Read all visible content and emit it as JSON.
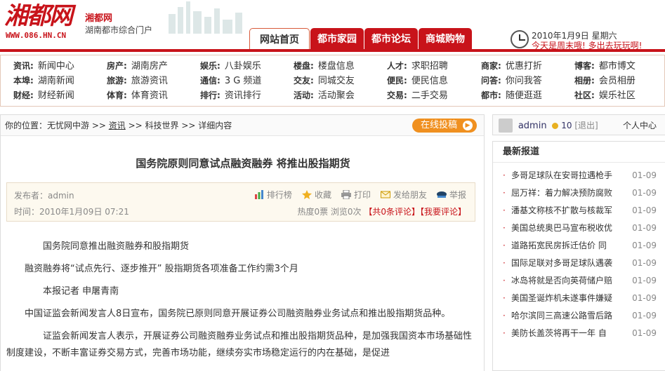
{
  "header": {
    "logo_text": "湘都网",
    "logo_url": "WWW.086.HN.CN",
    "site_name": "湘都网",
    "slogan": "湖南都市综合门户",
    "tabs": [
      "网站首页",
      "都市家园",
      "都市论坛",
      "商城购物"
    ],
    "date": "2010年1月9日 星期六",
    "tip": "今天是周末哦! 多出去玩玩啊!"
  },
  "catnav": [
    {
      "rows": [
        {
          "cat": "资讯:",
          "link": "新闻中心"
        },
        {
          "cat": "本埠:",
          "link": "湖南新闻"
        },
        {
          "cat": "财经:",
          "link": "财经新闻"
        }
      ]
    },
    {
      "rows": [
        {
          "cat": "房产:",
          "link": "湖南房产"
        },
        {
          "cat": "旅游:",
          "link": "旅游资讯"
        },
        {
          "cat": "体育:",
          "link": "体育资讯"
        }
      ]
    },
    {
      "rows": [
        {
          "cat": "娱乐:",
          "link": "八卦娱乐"
        },
        {
          "cat": "通信:",
          "link": "3 G 频道"
        },
        {
          "cat": "排行:",
          "link": "资讯排行"
        }
      ]
    },
    {
      "rows": [
        {
          "cat": "楼盘:",
          "link": "楼盘信息"
        },
        {
          "cat": "交友:",
          "link": "同城交友"
        },
        {
          "cat": "活动:",
          "link": "活动聚会"
        }
      ]
    },
    {
      "rows": [
        {
          "cat": "人才:",
          "link": "求职招聘"
        },
        {
          "cat": "便民:",
          "link": "便民信息"
        },
        {
          "cat": "交易:",
          "link": "二手交易"
        }
      ]
    },
    {
      "rows": [
        {
          "cat": "商家:",
          "link": "优惠打折"
        },
        {
          "cat": "问答:",
          "link": "你问我答"
        },
        {
          "cat": "都市:",
          "link": "随便逛逛"
        }
      ]
    },
    {
      "rows": [
        {
          "cat": "博客:",
          "link": "都市博文"
        },
        {
          "cat": "相册:",
          "link": "会员相册"
        },
        {
          "cat": "社区:",
          "link": "娱乐社区"
        }
      ]
    }
  ],
  "breadcrumb": {
    "prefix": "你的位置：无忧网中游 >>",
    "link": "资讯",
    "rest": ">> 科技世界 >> 详细内容"
  },
  "post_button": "在线投稿",
  "article": {
    "title": "国务院原则同意试点融资融券 将推出股指期货",
    "publisher": "发布者：admin",
    "time": "时间：2010年1月09日 07:21",
    "tools": [
      "排行榜",
      "收藏",
      "打印",
      "发给朋友",
      "举报"
    ],
    "stats_plain": "热度0票 浏览0次",
    "stats_red": "【共0条评论】【我要评论】",
    "paragraphs": [
      "国务院同意推出融资融券和股指期货",
      "融资融券将“试点先行、逐步推开” 股指期货各项准备工作约需3个月",
      "本报记者 申屠青南",
      "中国证监会新闻发言人8日宣布，国务院已原则同意开展证券公司融资融券业务试点和推出股指期货品种。",
      "证监会新闻发言人表示，开展证券公司融资融券业务试点和推出股指期货品种，是加强我国资本市场基础性制度建设，不断丰富证券交易方式，完善市场功能，继续夯实市场稳定运行的内在基础，是促进"
    ]
  },
  "user": {
    "name": "admin",
    "points": "10",
    "logout": "[退出]",
    "center": "个人中心"
  },
  "news": {
    "heading": "最新报道",
    "items": [
      {
        "title": "多哥足球队在安哥拉遇枪手",
        "date": "01-09"
      },
      {
        "title": "屈万祥：着力解决预防腐败",
        "date": "01-09"
      },
      {
        "title": "潘基文称核不扩散与核裁军",
        "date": "01-09"
      },
      {
        "title": "美国总统奥巴马宣布税收优",
        "date": "01-09"
      },
      {
        "title": "道路拓宽民房拆迁估价 同",
        "date": "01-09"
      },
      {
        "title": "国际足联对多哥足球队遇袭",
        "date": "01-09"
      },
      {
        "title": "冰岛将就是否向英荷储户赔",
        "date": "01-09"
      },
      {
        "title": "美国圣诞炸机未遂事件嫌疑",
        "date": "01-09"
      },
      {
        "title": "哈尔滨同三高速公路雪后路",
        "date": "01-09"
      },
      {
        "title": "美防长盖茨将再干一年 自",
        "date": "01-09"
      }
    ]
  }
}
